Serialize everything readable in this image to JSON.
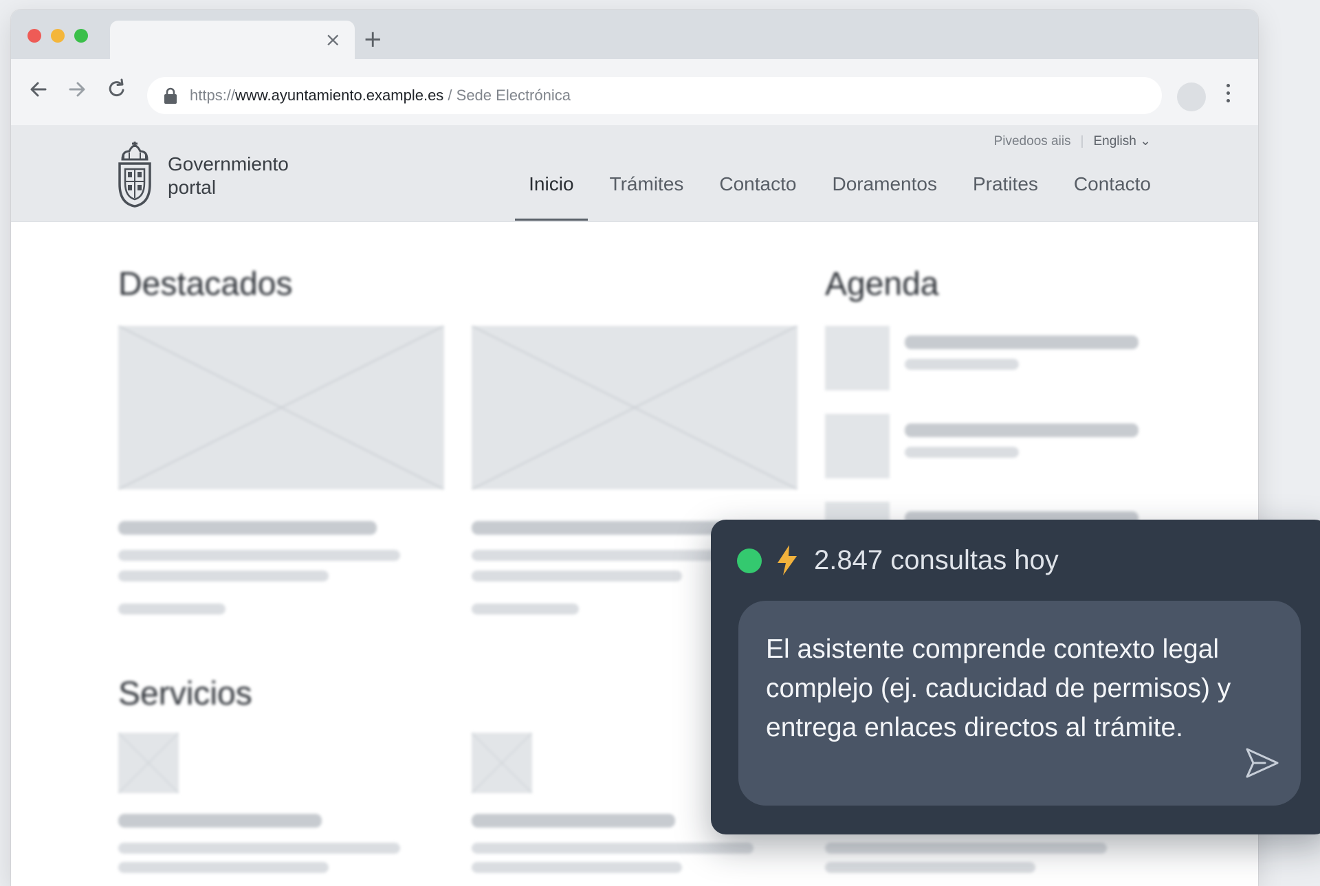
{
  "browser": {
    "tab_close": "×",
    "new_tab": "+",
    "url_scheme": "https://",
    "url_host": "www.ayuntamiento.example.es",
    "url_path": " / Sede Electrónica"
  },
  "site": {
    "logo_line1": "Governmiento",
    "logo_line2": "portal",
    "util_link": "Pivedoos aiis",
    "util_sep": "|",
    "language": "English ⌄",
    "nav": [
      {
        "label": "Inicio"
      },
      {
        "label": "Trámites"
      },
      {
        "label": "Contacto"
      },
      {
        "label": "Doramentos"
      },
      {
        "label": "Pratites"
      },
      {
        "label": "Contacto"
      }
    ]
  },
  "main": {
    "featured_title": "Destacados",
    "agenda_title": "Agenda",
    "services_title": "Servicios"
  },
  "chat": {
    "count_text": "2.847 consultas hoy",
    "status_color": "#34c96f",
    "message": "El asistente comprende contexto legal complejo (ej. caducidad de permisos) y entrega enlaces directos al trámite.",
    "send_icon": "send-icon"
  }
}
